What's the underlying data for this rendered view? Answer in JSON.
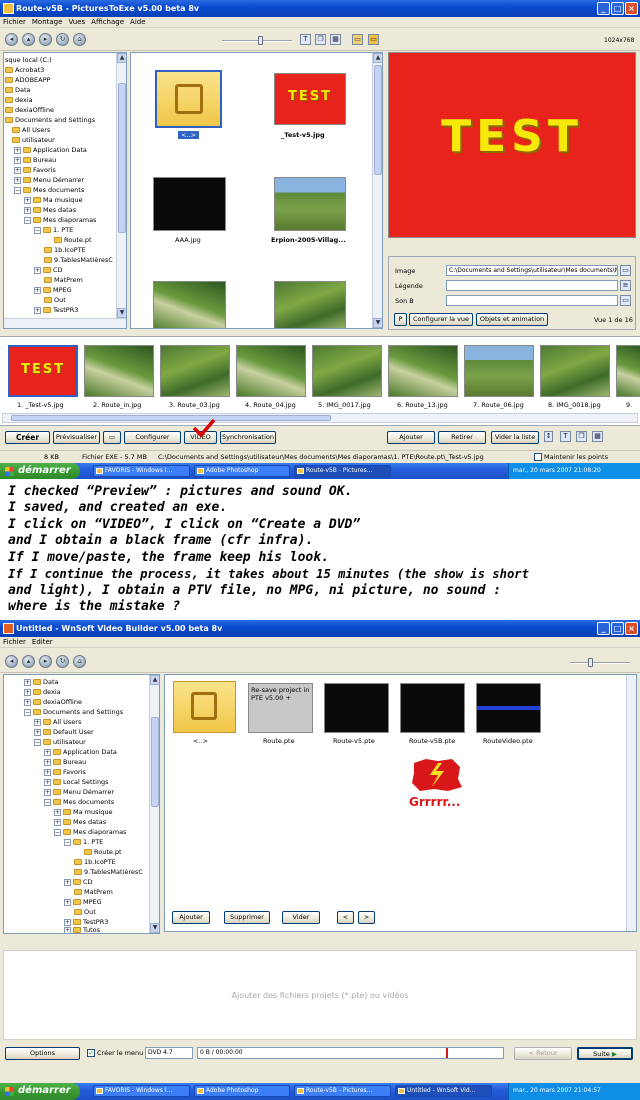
{
  "win1": {
    "title": "Route-v5B - PicturesToExe v5.00 beta 8v",
    "menu": [
      "Fichier",
      "Montage",
      "Vues",
      "Affichage",
      "Aide"
    ],
    "resolution": "1024x768",
    "tree": [
      "sque local (C:)",
      "Acrobat3",
      "ADOBEAPP",
      "Data",
      "dexia",
      "dexiaOffline",
      "Documents and Settings",
      "All Users",
      "utilisateur",
      "Application Data",
      "Bureau",
      "Favoris",
      "Menu Démarrer",
      "Mes documents",
      "Ma musique",
      "Mes datas",
      "Mes diaporamas",
      "1. PTE",
      "Route.pt",
      "1b.IcoPTE",
      "9.TablesMatièresC",
      "CD",
      "MatPrem",
      "MPEG",
      "Out",
      "TestPR3"
    ],
    "files": [
      {
        "name": "<..>",
        "kind": "up"
      },
      {
        "name": "_Test-v5.jpg",
        "kind": "test"
      },
      {
        "name": "AAA.jpg",
        "kind": "black"
      },
      {
        "name": "Erpion-2005-Villag...",
        "kind": "green"
      },
      {
        "name": "",
        "kind": "green2"
      },
      {
        "name": "",
        "kind": "green"
      }
    ],
    "preview_text": "TEST",
    "props": {
      "image_label": "Image",
      "image_value": "C:\\Documents and Settings\\utilisateur\\Mes documents\\Me",
      "caption_label": "Légende",
      "sound_label": "Son B",
      "p_button": "P",
      "configure_view": "Configurer la vue",
      "objects_anim": "Objets et animation",
      "view_count": "Vue 1 de 16"
    },
    "strip": [
      "1. _Test-v5.jpg",
      "2. Route_in.jpg",
      "3. Route_03.jpg",
      "4. Route_04.jpg",
      "5. IMG_0017.jpg",
      "6. Route_13.jpg",
      "7. Route_06.jpg",
      "8. IMG_0018.jpg",
      "9."
    ],
    "buttons": {
      "create": "Créer",
      "preview": "Prévisualiser",
      "configure": "Configurer",
      "video": "VIDEO",
      "sync": "Synchronisation",
      "add": "Ajouter",
      "remove": "Retirer",
      "clear": "Vider la liste"
    },
    "status": {
      "size": "8 KB",
      "exe": "Fichier EXE - 5.7 MB",
      "path": "C:\\Documents and Settings\\utilisateur\\Mes documents\\Mes diaporamas\\1. PTE\\Route.pt\\_Test-v5.jpg",
      "keep_points": "Maintenir les points"
    }
  },
  "taskbar1": {
    "start": "démarrer",
    "tasks": [
      "FAVORIS - Windows I...",
      "Adobe Photoshop",
      "Route-v5B - Pictures..."
    ],
    "clock": "mar., 20 mars 2007  21:08:20"
  },
  "message": [
    "I checked “Preview” : pictures and sound OK.",
    "I saved, and created an exe.",
    "I click on “VIDEO”, I click on “Create a DVD”",
    "and I obtain a black frame (cfr infra).",
    "If I move/paste, the frame keep his look.",
    "If I continue the process, it takes about 15 minutes (the show is short",
    "and light), I obtain a PTV file, no MPG, ni picture, no sound :",
    "where is the mistake ?"
  ],
  "win2": {
    "title": "Untitled - WnSoft Video Builder v5.00 beta 8v",
    "menu": [
      "Fichier",
      "Editer"
    ],
    "tree": [
      "Data",
      "dexia",
      "dexiaOffline",
      "Documents and Settings",
      "All Users",
      "Default User",
      "utilisateur",
      "Application Data",
      "Bureau",
      "Favoris",
      "Local Settings",
      "Menu Démarrer",
      "Mes documents",
      "Ma musique",
      "Mes datas",
      "Mes diaporamas",
      "1. PTE",
      "Route.pt",
      "1b.IcoPTE",
      "9.TablesMatièresC",
      "CD",
      "MatPrem",
      "MPEG",
      "Out",
      "TestPR3",
      "Tutos"
    ],
    "files": [
      {
        "name": "<..>",
        "kind": "up"
      },
      {
        "name": "Route.pte",
        "kind": "resave"
      },
      {
        "name": "Route-v5.pte",
        "kind": "black"
      },
      {
        "name": "Route-v5B.pte",
        "kind": "black"
      },
      {
        "name": "RouteVideo.pte",
        "kind": "video"
      }
    ],
    "resave_text": "Re-save project in PTE v5.00 +",
    "grrr": "Grrrrr...",
    "buttons": {
      "add": "Ajouter",
      "remove": "Supprimer",
      "clear": "Vider",
      "prev": "<",
      "next": ">",
      "options": "Options",
      "create_menu": "Créer le menu",
      "dvd": "DVD 4.7",
      "back": "< Retour",
      "next_step": "Suite"
    },
    "empty_hint": "Ajouter des fichiers projets (*.pte) ou vidéos",
    "progress_text": "0 B / 00:00:00"
  },
  "taskbar2": {
    "start": "démarrer",
    "tasks": [
      "FAVORIS - Windows I...",
      "Adobe Photoshop",
      "Route-v5B - Pictures...",
      "Untitled - WnSoft Vid..."
    ],
    "clock": "mar., 20 mars 2007  21:04:57"
  }
}
